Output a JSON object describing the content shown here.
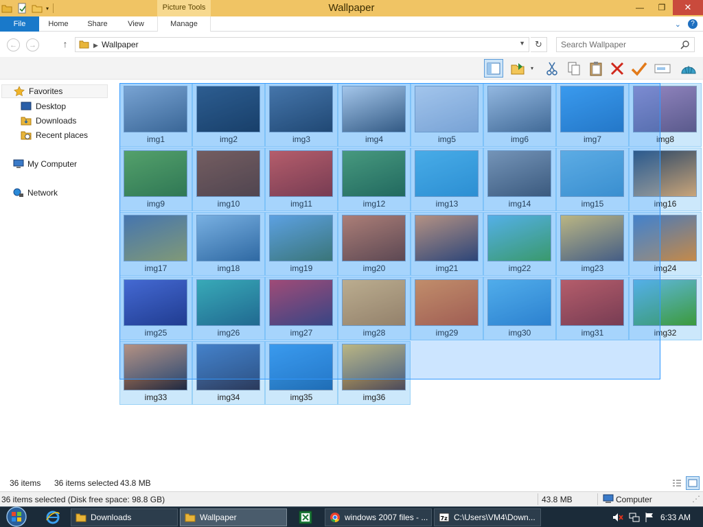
{
  "window": {
    "title": "Wallpaper",
    "contextual_tab": "Picture Tools"
  },
  "ribbon": {
    "file": "File",
    "tabs": [
      "Home",
      "Share",
      "View",
      "Manage"
    ]
  },
  "address": {
    "crumb": "Wallpaper"
  },
  "search": {
    "placeholder": "Search Wallpaper"
  },
  "nav": {
    "favorites": "Favorites",
    "desktop": "Desktop",
    "downloads": "Downloads",
    "recent": "Recent places",
    "computer": "My Computer",
    "network": "Network"
  },
  "files": [
    {
      "name": "img1",
      "colors": [
        "#8fa7c4",
        "#3c5674"
      ]
    },
    {
      "name": "img2",
      "colors": [
        "#2b4a6c",
        "#0f2238"
      ]
    },
    {
      "name": "img3",
      "colors": [
        "#4b6a8e",
        "#1a2e46"
      ]
    },
    {
      "name": "img4",
      "colors": [
        "#c9d5e3",
        "#33465c"
      ]
    },
    {
      "name": "img5",
      "colors": [
        "#c7d4e6",
        "#8fa6c7"
      ]
    },
    {
      "name": "img6",
      "colors": [
        "#b2c2d6",
        "#465b74"
      ]
    },
    {
      "name": "img7",
      "colors": [
        "#3c9be8",
        "#1f6db6"
      ]
    },
    {
      "name": "img8",
      "colors": [
        "#9487c2",
        "#5a5a8c"
      ]
    },
    {
      "name": "img9",
      "colors": [
        "#5fa43a",
        "#2e6d1c"
      ]
    },
    {
      "name": "img10",
      "colors": [
        "#8a4a2c",
        "#5a2a16"
      ]
    },
    {
      "name": "img11",
      "colors": [
        "#e04a3a",
        "#8e1e1a"
      ]
    },
    {
      "name": "img12",
      "colors": [
        "#4e9a54",
        "#1c5a2a"
      ]
    },
    {
      "name": "img13",
      "colors": [
        "#4fb3e0",
        "#2a8cc4"
      ]
    },
    {
      "name": "img14",
      "colors": [
        "#8a93a0",
        "#3e4654"
      ]
    },
    {
      "name": "img15",
      "colors": [
        "#6ab3dc",
        "#3c8cc0"
      ]
    },
    {
      "name": "img16",
      "colors": [
        "#2a4666",
        "#c9a57a"
      ]
    },
    {
      "name": "img17",
      "colors": [
        "#4c6a94",
        "#9a9a4a"
      ]
    },
    {
      "name": "img18",
      "colors": [
        "#8fb8d8",
        "#2e5a84"
      ]
    },
    {
      "name": "img19",
      "colors": [
        "#6aa4d8",
        "#3c6a4c"
      ]
    },
    {
      "name": "img20",
      "colors": [
        "#d4764a",
        "#6a2e1a"
      ]
    },
    {
      "name": "img21",
      "colors": [
        "#e0905a",
        "#2a2a4c"
      ]
    },
    {
      "name": "img22",
      "colors": [
        "#5fb8e0",
        "#3c9a3c"
      ]
    },
    {
      "name": "img23",
      "colors": [
        "#e8c05a",
        "#4a4a5c"
      ]
    },
    {
      "name": "img24",
      "colors": [
        "#4a7ab8",
        "#c48a4a"
      ]
    },
    {
      "name": "img25",
      "colors": [
        "#4a5ac4",
        "#1a1e6c"
      ]
    },
    {
      "name": "img26",
      "colors": [
        "#3ab0a0",
        "#1a5a6c"
      ]
    },
    {
      "name": "img27",
      "colors": [
        "#c4324a",
        "#3a2a5c"
      ]
    },
    {
      "name": "img28",
      "colors": [
        "#e8b46a",
        "#b47a3a"
      ]
    },
    {
      "name": "img29",
      "colors": [
        "#f08a3a",
        "#c44a1a"
      ]
    },
    {
      "name": "img30",
      "colors": [
        "#5ab4e4",
        "#2a7ac0"
      ]
    },
    {
      "name": "img31",
      "colors": [
        "#e04a3a",
        "#8e1e1a"
      ]
    },
    {
      "name": "img32",
      "colors": [
        "#5fb8e0",
        "#3c9a3c"
      ]
    },
    {
      "name": "img33",
      "colors": [
        "#e0905a",
        "#1e2a44"
      ]
    },
    {
      "name": "img34",
      "colors": [
        "#4a7ab8",
        "#2a3a5c"
      ]
    },
    {
      "name": "img35",
      "colors": [
        "#3c9be8",
        "#1f6db6"
      ]
    },
    {
      "name": "img36",
      "colors": [
        "#e8c05a",
        "#4a4a5c"
      ]
    }
  ],
  "status": {
    "items": "36 items",
    "selected": "36 items selected",
    "size": "43.8 MB"
  },
  "details": {
    "summary": "36 items selected (Disk free space: 98.8 GB)",
    "size": "43.8 MB",
    "location": "Computer"
  },
  "taskbar": {
    "items": [
      {
        "label": "Downloads",
        "icon": "folder-icon"
      },
      {
        "label": "Wallpaper",
        "icon": "folder-icon"
      },
      {
        "label": "windows 2007 files - ...",
        "icon": "chrome-icon"
      },
      {
        "label": "C:\\Users\\VM4\\Down...",
        "icon": "7zip-icon"
      }
    ],
    "clock": "6:33 AM"
  }
}
